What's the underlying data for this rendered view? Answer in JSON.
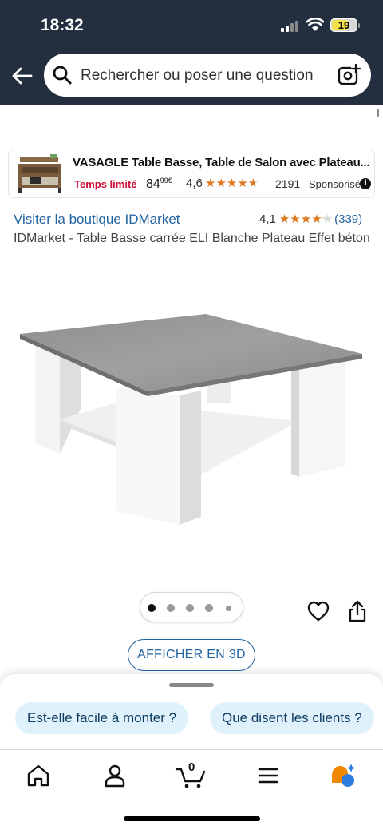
{
  "status_bar": {
    "time": "18:32",
    "battery": "19"
  },
  "search": {
    "placeholder": "Rechercher ou poser une question"
  },
  "sponsored": {
    "title": "VASAGLE Table Basse, Table de Salon avec Plateau...",
    "deal": "Temps limité",
    "price_main": "84",
    "price_cents": "99€",
    "rating": "4,6",
    "review_count": "2191",
    "label": "Sponsorisé",
    "stars": 4.6
  },
  "product": {
    "store_link": "Visiter la boutique IDMarket",
    "rating": "4,1",
    "rating_count": "(339)",
    "stars": 4.1,
    "title": "IDMarket - Table Basse carrée ELI Blanche Plateau Effet béton",
    "image_count": 5,
    "current_image": 1
  },
  "actions": {
    "view_3d": "AFFICHER EN 3D"
  },
  "questions": {
    "chips": [
      "Est-elle facile à monter ?",
      "Que disent les clients ?"
    ]
  },
  "tabbar": {
    "cart_count": "0",
    "items": [
      "home-icon",
      "account-icon",
      "cart-icon",
      "menu-icon",
      "rufus-icon"
    ]
  },
  "colors": {
    "header": "#232f3e",
    "link": "#2162a1",
    "deal": "#cc0c39",
    "star": "#de7921",
    "chip": "#dff1fa",
    "cart_badge": "#f08804"
  }
}
